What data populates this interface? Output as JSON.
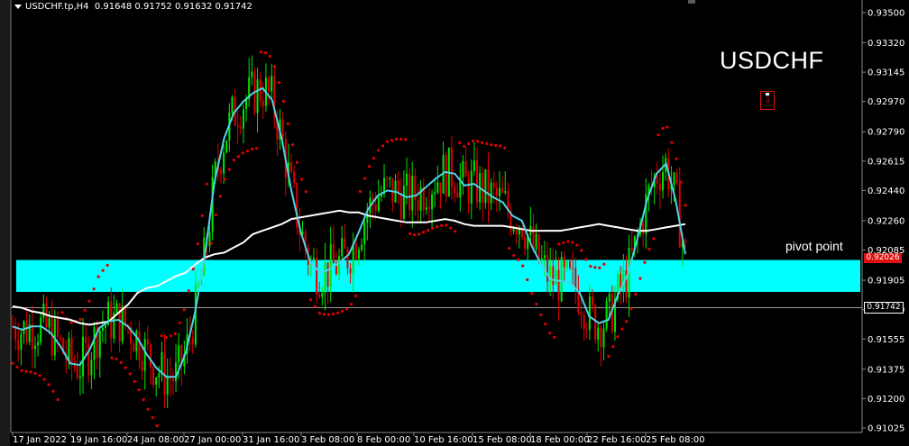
{
  "header": {
    "symbol": "USDCHF.tp,H4",
    "ohlc": "0.91648 0.91752 0.91632 0.91742"
  },
  "title": "USDCHF",
  "pivot_label": "pivot point",
  "price_tags": {
    "pivot": "0.92026",
    "current": "0.91742"
  },
  "y_axis": [
    "0.93500",
    "0.93320",
    "0.93145",
    "0.92970",
    "0.92790",
    "0.92615",
    "0.92440",
    "0.92260",
    "0.92085",
    "0.91905",
    "0.91730",
    "0.91555",
    "0.91375",
    "0.91200",
    "0.91025"
  ],
  "x_axis": [
    "17 Jan 2022",
    "19 Jan 16:00",
    "24 Jan 08:00",
    "27 Jan 00:00",
    "31 Jan 16:00",
    "3 Feb 08:00",
    "8 Feb 00:00",
    "10 Feb 16:00",
    "15 Feb 08:00",
    "18 Feb 00:00",
    "22 Feb 16:00",
    "25 Feb 08:00"
  ],
  "colors": {
    "bull": "#00e600",
    "bear": "#e00000",
    "fast_ma": "#4fd3e8",
    "slow_ma": "#ffffff",
    "zone": "#00ffff",
    "sar": "#e00000"
  },
  "chart_data": {
    "type": "candlestick",
    "symbol": "USDCHF",
    "timeframe": "H4",
    "ylim": [
      0.91025,
      0.935
    ],
    "pivot_zone": [
      0.91836,
      0.92026
    ],
    "current_price": 0.91742,
    "pivot_level": 0.92026,
    "series": [
      {
        "name": "fast_ma",
        "values": [
          0.9163,
          0.9161,
          0.9163,
          0.9163,
          0.9159,
          0.9151,
          0.9141,
          0.914,
          0.9149,
          0.9162,
          0.9166,
          0.9167,
          0.9163,
          0.9156,
          0.9146,
          0.9138,
          0.9133,
          0.9133,
          0.9147,
          0.9172,
          0.9205,
          0.9249,
          0.9275,
          0.929,
          0.9297,
          0.9302,
          0.9305,
          0.9298,
          0.9275,
          0.9244,
          0.9219,
          0.9201,
          0.9195,
          0.9197,
          0.9201,
          0.9206,
          0.9219,
          0.9233,
          0.9241,
          0.9244,
          0.9243,
          0.924,
          0.9241,
          0.9246,
          0.9251,
          0.9255,
          0.9254,
          0.9247,
          0.9248,
          0.9244,
          0.924,
          0.9237,
          0.9229,
          0.9226,
          0.9211,
          0.92,
          0.9191,
          0.919,
          0.9189,
          0.9183,
          0.9169,
          0.9165,
          0.9167,
          0.9182,
          0.9194,
          0.9215,
          0.9238,
          0.9254,
          0.926,
          0.9238,
          0.9206
        ]
      },
      {
        "name": "slow_ma",
        "values": [
          0.9175,
          0.9174,
          0.9172,
          0.9171,
          0.9169,
          0.9168,
          0.9167,
          0.9165,
          0.9164,
          0.9165,
          0.9166,
          0.9171,
          0.9176,
          0.9183,
          0.9186,
          0.9187,
          0.919,
          0.9193,
          0.9195,
          0.92,
          0.9204,
          0.9206,
          0.9207,
          0.921,
          0.9213,
          0.9218,
          0.922,
          0.9222,
          0.9224,
          0.9227,
          0.9228,
          0.9229,
          0.923,
          0.9231,
          0.9232,
          0.9231,
          0.9231,
          0.9229,
          0.9228,
          0.9227,
          0.9226,
          0.9225,
          0.9225,
          0.9225,
          0.9226,
          0.9227,
          0.9226,
          0.9224,
          0.9223,
          0.9223,
          0.9223,
          0.9223,
          0.9222,
          0.9221,
          0.922,
          0.922,
          0.922,
          0.922,
          0.9221,
          0.9222,
          0.9223,
          0.9224,
          0.9223,
          0.9222,
          0.9221,
          0.922,
          0.922,
          0.9221,
          0.9222,
          0.9223,
          0.9224
        ]
      }
    ]
  }
}
